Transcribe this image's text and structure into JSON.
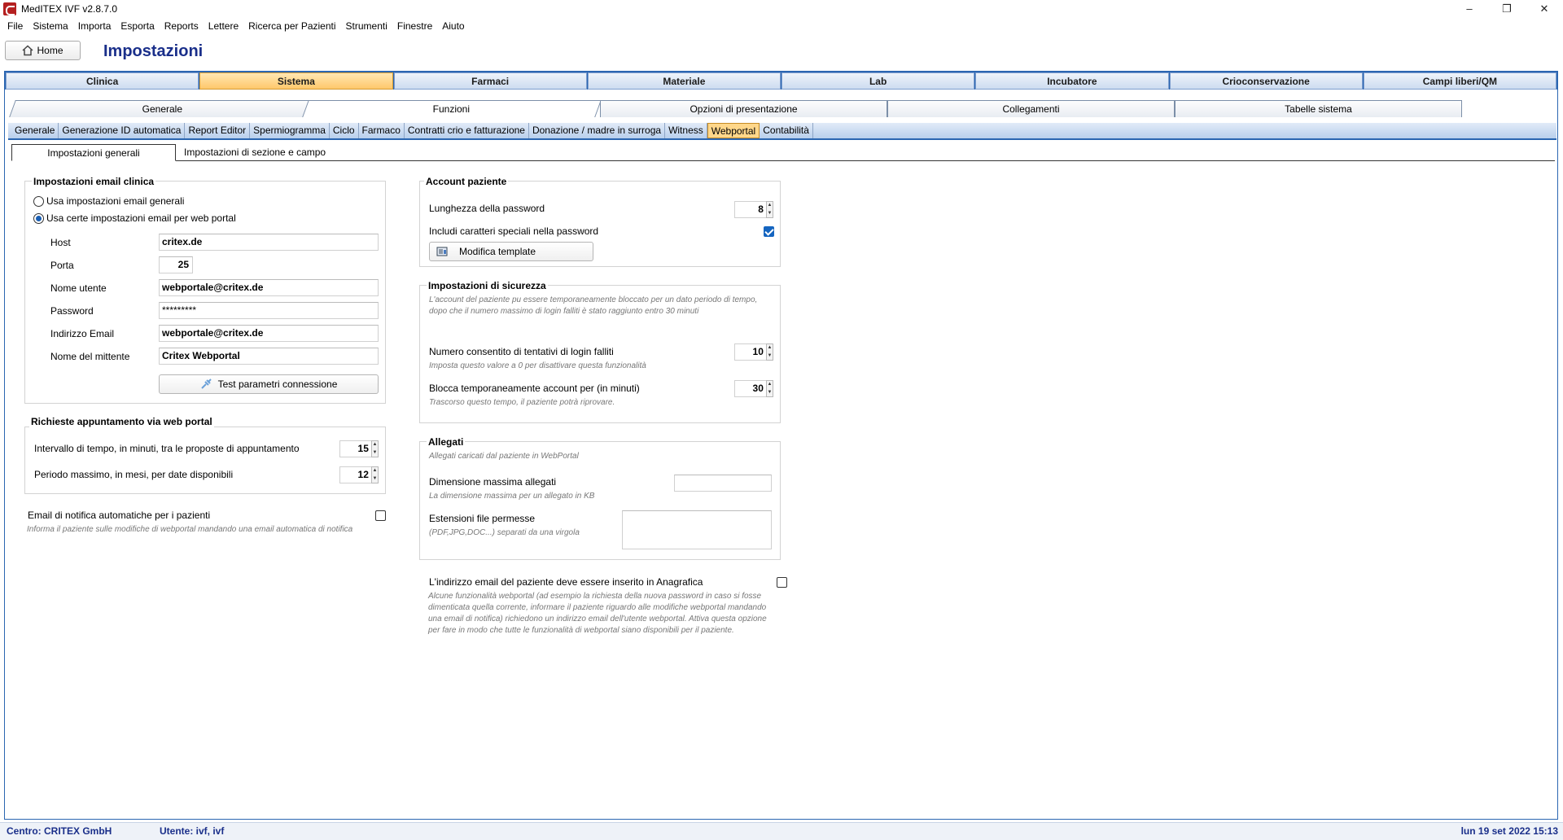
{
  "window": {
    "title": "MedITEX IVF v2.8.7.0",
    "minimize": "–",
    "restore": "❐",
    "close": "✕"
  },
  "menu": [
    "File",
    "Sistema",
    "Importa",
    "Esporta",
    "Reports",
    "Lettere",
    "Ricerca per Pazienti",
    "Strumenti",
    "Finestre",
    "Aiuto"
  ],
  "home": {
    "label": "Home",
    "title": "Impostazioni"
  },
  "main_tabs": [
    "Clinica",
    "Sistema",
    "Farmaci",
    "Materiale",
    "Lab",
    "Incubatore",
    "Crioconservazione",
    "Campi liberi/QM"
  ],
  "main_tab_active": "Sistema",
  "sub_tabs1": [
    "Generale",
    "Funzioni",
    "Opzioni di presentazione",
    "Collegamenti",
    "Tabelle sistema"
  ],
  "sub_tabs2": [
    "Generale",
    "Generazione ID automatica",
    "Report Editor",
    "Spermiogramma",
    "Ciclo",
    "Farmaco",
    "Contratti crio e fatturazione",
    "Donazione / madre in surroga",
    "Witness",
    "Webportal",
    "Contabilità"
  ],
  "sub_tabs3": [
    "Impostazioni generali",
    "Impostazioni di sezione e campo"
  ],
  "email_clinic": {
    "title": "Impostazioni email clinica",
    "radio1": "Usa impostazioni email generali",
    "radio2": "Usa certe impostazioni email per web portal",
    "host_label": "Host",
    "host": "critex.de",
    "port_label": "Porta",
    "port": "25",
    "user_label": "Nome utente",
    "user": "webportale@critex.de",
    "password_label": "Password",
    "password": "*********",
    "email_label": "Indirizzo Email",
    "email": "webportale@critex.de",
    "sender_label": "Nome del mittente",
    "sender": "Critex Webportal",
    "test_button": "Test parametri connessione"
  },
  "appointments": {
    "title": "Richieste appuntamento via web portal",
    "interval_label": "Intervallo di tempo, in minuti, tra le proposte di appuntamento",
    "interval": "15",
    "period_label": "Periodo massimo, in mesi, per date disponibili",
    "period": "12"
  },
  "notify": {
    "label": "Email di notifica automatiche per i pazienti",
    "hint": "Informa il paziente sulle modifiche di webportal mandando una email automatica di notifica",
    "checked": false
  },
  "account": {
    "title": "Account paziente",
    "pw_length_label": "Lunghezza della password",
    "pw_length": "8",
    "special_label": "Includi caratteri speciali nella password",
    "special_checked": true,
    "template_button": "Modifica template"
  },
  "security": {
    "title": "Impostazioni di sicurezza",
    "hint": "L'account del paziente pu essere temporaneamente bloccato per un dato periodo di tempo, dopo che il numero massimo di login falliti è stato raggiunto entro 30 minuti",
    "attempts_label": "Numero consentito di tentativi di login falliti",
    "attempts": "10",
    "attempts_hint": "Imposta questo valore a 0 per disattivare questa funzionalità",
    "lock_label": "Blocca temporaneamente account per (in minuti)",
    "lock": "30",
    "lock_hint": "Trascorso questo tempo, il paziente potrà riprovare."
  },
  "attachments": {
    "title": "Allegati",
    "hint": "Allegati caricati dal paziente in WebPortal",
    "max_label": "Dimensione massima allegati",
    "max_hint": "La dimensione massima per un allegato in KB",
    "max": "",
    "ext_label": "Estensioni file permesse",
    "ext_hint": "(PDF,JPG,DOC...) separati da una virgola",
    "ext": ""
  },
  "email_required": {
    "label": "L'indirizzo email del paziente deve essere inserito in Anagrafica",
    "hint": "Alcune funzionalità webportal (ad esempio la richiesta della nuova password in caso si fosse dimenticata quella corrente, informare il paziente riguardo alle modifiche webportal mandando una email di notifica) richiedono un indirizzo email dell'utente webportal. Attiva questa opzione per fare in modo che tutte le funzionalità di webportal siano disponibili per il paziente.",
    "checked": false
  },
  "status": {
    "centro": "Centro: CRITEX GmbH",
    "utente": "Utente: ivf, ivf",
    "datetime": "lun 19 set 2022 15:13"
  },
  "colors": {
    "accent": "#2b66b1",
    "active_tab": "#ffc86b",
    "title": "#1a2f8a"
  }
}
